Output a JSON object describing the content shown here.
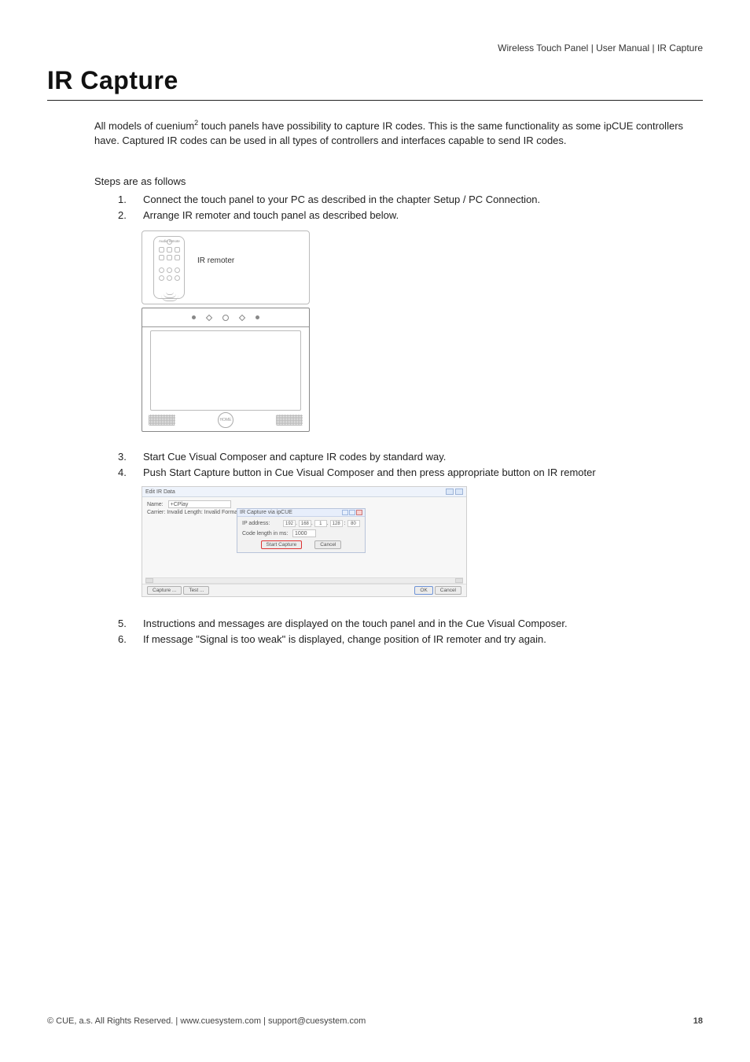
{
  "header": {
    "product": "Wireless Touch Panel",
    "doc": "User Manual",
    "section": "IR Capture"
  },
  "title": "IR Capture",
  "intro_parts": {
    "p1": "All models of cuenium",
    "sup": "2",
    "p2": " touch panels have possibility to capture IR codes. This is the same functionality as some ipCUE controllers have. Captured IR codes can be used in all types of controllers and interfaces capable to send IR codes."
  },
  "steps_lead": "Steps are as follows",
  "steps": [
    {
      "n": "1.",
      "t": "Connect the touch panel to your PC as described in the chapter Setup / PC Connection."
    },
    {
      "n": "2.",
      "t": "Arrange IR remoter and touch panel as described below."
    }
  ],
  "figA": {
    "remote_brand": "Audio remote",
    "ir_label": "IR remoter",
    "home_label": "HOME"
  },
  "steps2": [
    {
      "n": "3.",
      "t": "Start Cue Visual Composer and capture IR codes by standard way."
    },
    {
      "n": "4.",
      "t": "Push Start Capture button in Cue Visual Composer and then press appropriate button on IR remoter"
    }
  ],
  "figC": {
    "win_title": "Edit IR Data",
    "name_label": "Name:",
    "name_value": "+CPlay",
    "status": "Carrier: Invalid  Length: Invalid  Format: RAW",
    "dlg_title": "IR Capture via ipCUE",
    "ip_label": "IP address:",
    "ip": [
      "192",
      "168",
      "1",
      "128",
      "80"
    ],
    "codelen_label": "Code length in ms:",
    "codelen_value": "1000",
    "btn_start": "Start Capture",
    "btn_cancel_dlg": "Cancel",
    "btn_capture": "Capture ...",
    "btn_test": "Test ...",
    "btn_ok": "OK",
    "btn_cancel": "Cancel"
  },
  "steps3": [
    {
      "n": "5.",
      "t": "Instructions and messages are displayed on the touch panel and in the Cue Visual Composer."
    },
    {
      "n": "6.",
      "t": "If message \"Signal is too weak\" is displayed, change position of IR remoter and try again."
    }
  ],
  "footer": {
    "left_prefix": "© CUE, a.s. All Rights Reserved.",
    "site": "www.cuesystem.com",
    "email": "support@cuesystem.com",
    "page": "18"
  }
}
